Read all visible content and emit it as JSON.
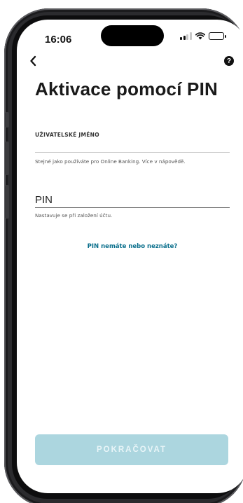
{
  "status_bar": {
    "time": "16:06",
    "battery_level": 0.45
  },
  "nav": {
    "back_icon": "chevron-left-icon",
    "help_label": "?"
  },
  "page": {
    "title": "Aktivace pomocí PIN"
  },
  "username": {
    "label": "UŽIVATELSKÉ JMÉNO",
    "value": "",
    "hint": "Stejné jako používáte pro Online Banking. Více v nápovědě."
  },
  "pin": {
    "placeholder": "PIN",
    "value": "",
    "hint": "Nastavuje se při založení účtu."
  },
  "links": {
    "forgot_pin": "PIN nemáte nebo neznáte?"
  },
  "actions": {
    "continue_label": "POKRAČOVAT"
  },
  "colors": {
    "link": "#0a6f8c",
    "button_disabled": "#acd6df",
    "title": "#1a1a1a"
  }
}
